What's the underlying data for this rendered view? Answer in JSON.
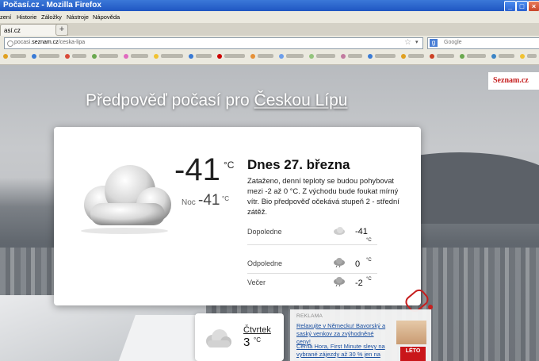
{
  "window": {
    "title": "Počasí.cz - Mozilla Firefox",
    "min": "_",
    "max": "□",
    "close": "×"
  },
  "menu": [
    "zení",
    "Historie",
    "Záložky",
    "Nástroje",
    "Nápověda"
  ],
  "tab": {
    "label": "así.cz",
    "close": "×",
    "new_tab": "+"
  },
  "navbar": {
    "url_host_pre": "pocasi.",
    "url_host": "seznam.cz",
    "url_path": "/ceska-lipa",
    "search_placeholder": "Google",
    "search_engine_letter": "g"
  },
  "page": {
    "logo": "Seznam.cz",
    "title_prefix": "Předpověď počasí pro ",
    "title_city": "Českou Lípu",
    "current_temp": "-41",
    "unit": "°C",
    "night_label": "Noc",
    "night_temp": "-41",
    "day_title": "Dnes 27. března",
    "description": "Zataženo, denní teploty se budou pohybovat mezi -2 až 0 °C. Z východu bude foukat mírný vítr. Bio předpověď očekává stupeň 2 - střední zátěž.",
    "periods": [
      {
        "label": "Dopoledne",
        "temp": "-41",
        "unit": "°C",
        "icon": "cloud-icon"
      },
      {
        "label": "Odpoledne",
        "temp": "0",
        "unit": "°C",
        "icon": "cloud-rain-icon"
      },
      {
        "label": "Večer",
        "temp": "-2",
        "unit": "°C",
        "icon": "cloud-rain-icon"
      }
    ],
    "next_day": {
      "label": "Čtvrtek",
      "temp": "3",
      "unit": "°C"
    },
    "ads": {
      "header": "REKLAMA",
      "ad1": "Relaxujte v Německu! Bavorský a saský venkov za zvýhodněné ceny!",
      "ad2": "Černá Hora, First Minute slevy na vybrané zájezdy až 30 % jen na",
      "badge": "LÉTO"
    }
  },
  "colors": {
    "brand": "#c61f1f",
    "titlebar": "#2a62d0",
    "link": "#1a4fa0"
  }
}
